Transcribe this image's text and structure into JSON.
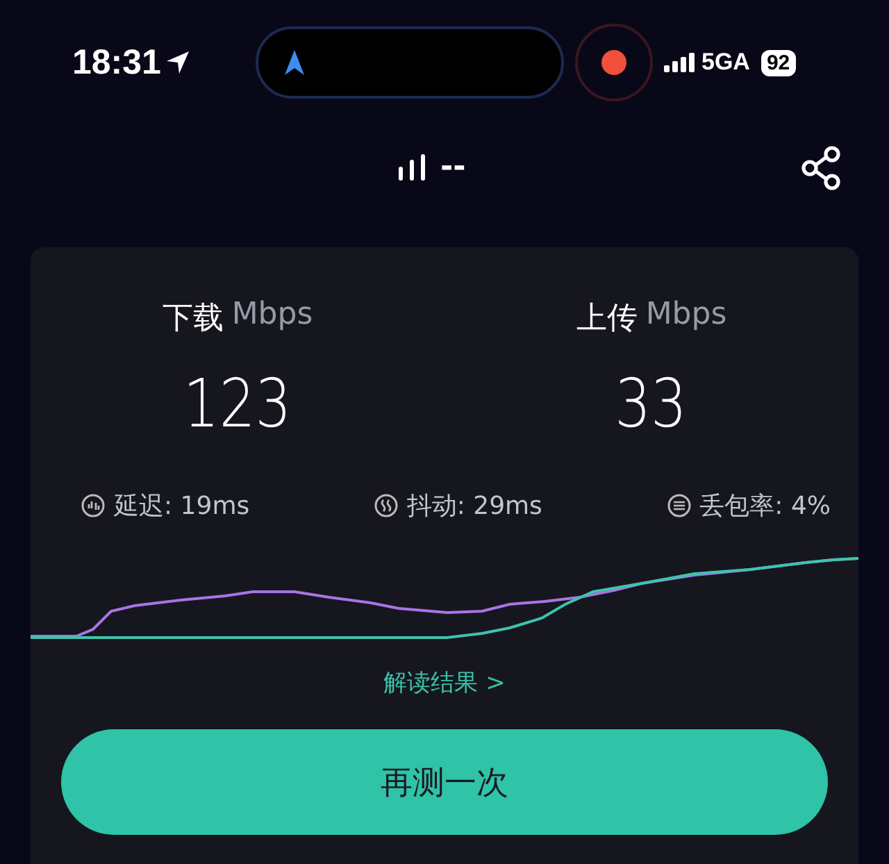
{
  "status_bar": {
    "time": "18:31",
    "network": "5GA",
    "battery": "92"
  },
  "header": {
    "signal_text": "--"
  },
  "results": [
    {
      "label": "下载",
      "unit": "Mbps",
      "value": "123"
    },
    {
      "label": "上传",
      "unit": "Mbps",
      "value": "33"
    }
  ],
  "metrics": [
    {
      "kind": "latency",
      "text": "延迟: 19ms"
    },
    {
      "kind": "jitter",
      "text": "抖动: 29ms"
    },
    {
      "kind": "loss",
      "text": "丢包率: 4%"
    }
  ],
  "link": "解读结果 >",
  "button": "再测一次"
}
